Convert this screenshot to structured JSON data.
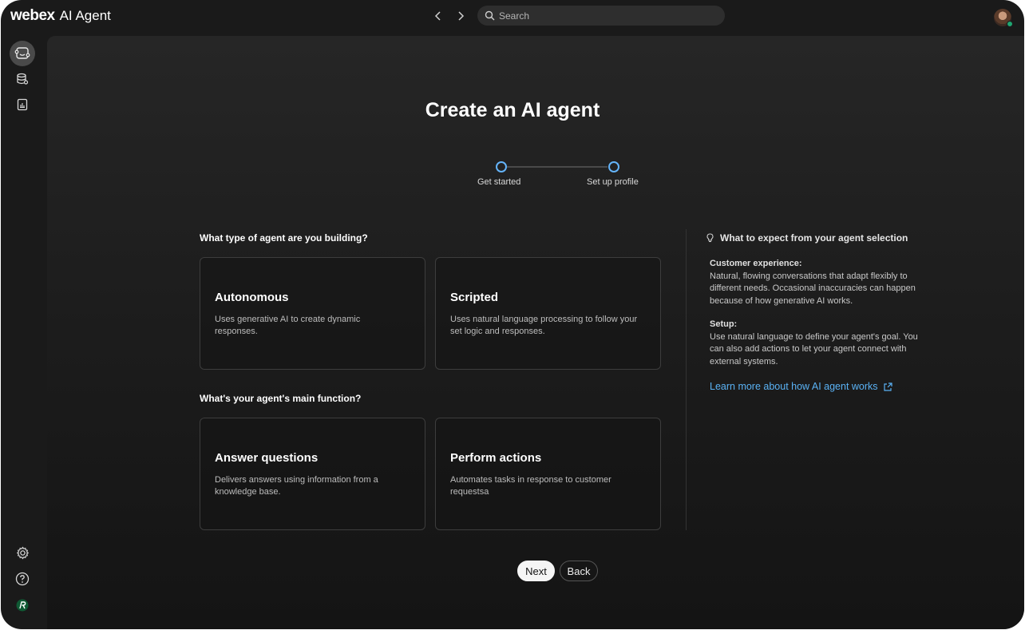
{
  "topbar": {
    "brand_logo": "webex",
    "app_name": "AI Agent",
    "back_icon": "chevron-left-icon",
    "forward_icon": "chevron-right-icon",
    "search_placeholder": "Search",
    "avatar_status_color": "#1fa672"
  },
  "sidebar": {
    "top_items": [
      {
        "icon": "ai-agent-icon",
        "active": true
      },
      {
        "icon": "database-icon",
        "active": false
      },
      {
        "icon": "report-icon",
        "active": false
      }
    ],
    "bottom_items": [
      {
        "icon": "gear-icon"
      },
      {
        "icon": "help-icon"
      },
      {
        "icon": "org-logo-icon"
      }
    ]
  },
  "main": {
    "title": "Create an AI agent",
    "steps": [
      {
        "label": "Get started"
      },
      {
        "label": "Set up profile"
      }
    ],
    "question_type": "What type of agent are you building?",
    "type_cards": [
      {
        "title": "Autonomous",
        "description": "Uses generative AI to create dynamic responses."
      },
      {
        "title": "Scripted",
        "description": "Uses natural language processing to follow your set logic and responses."
      }
    ],
    "question_function": "What's your agent's main function?",
    "function_cards": [
      {
        "title": "Answer questions",
        "description": "Delivers answers using information from a knowledge base."
      },
      {
        "title": "Perform actions",
        "description": "Automates tasks in response to customer requestsa"
      }
    ],
    "next_label": "Next",
    "back_label": "Back"
  },
  "info": {
    "heading": "What to expect from your agent selection",
    "customer_label": "Customer experience:",
    "customer_text": "Natural, flowing conversations that adapt flexibly to different needs. Occasional inaccuracies can happen because of how generative AI works.",
    "setup_label": "Setup:",
    "setup_text": "Use natural language to define your agent's goal. You can also add actions to let your agent connect with external systems.",
    "link_label": "Learn more about how AI agent works",
    "link_color": "#5ab2f5"
  },
  "colors": {
    "step_accent": "#64b4fa"
  }
}
